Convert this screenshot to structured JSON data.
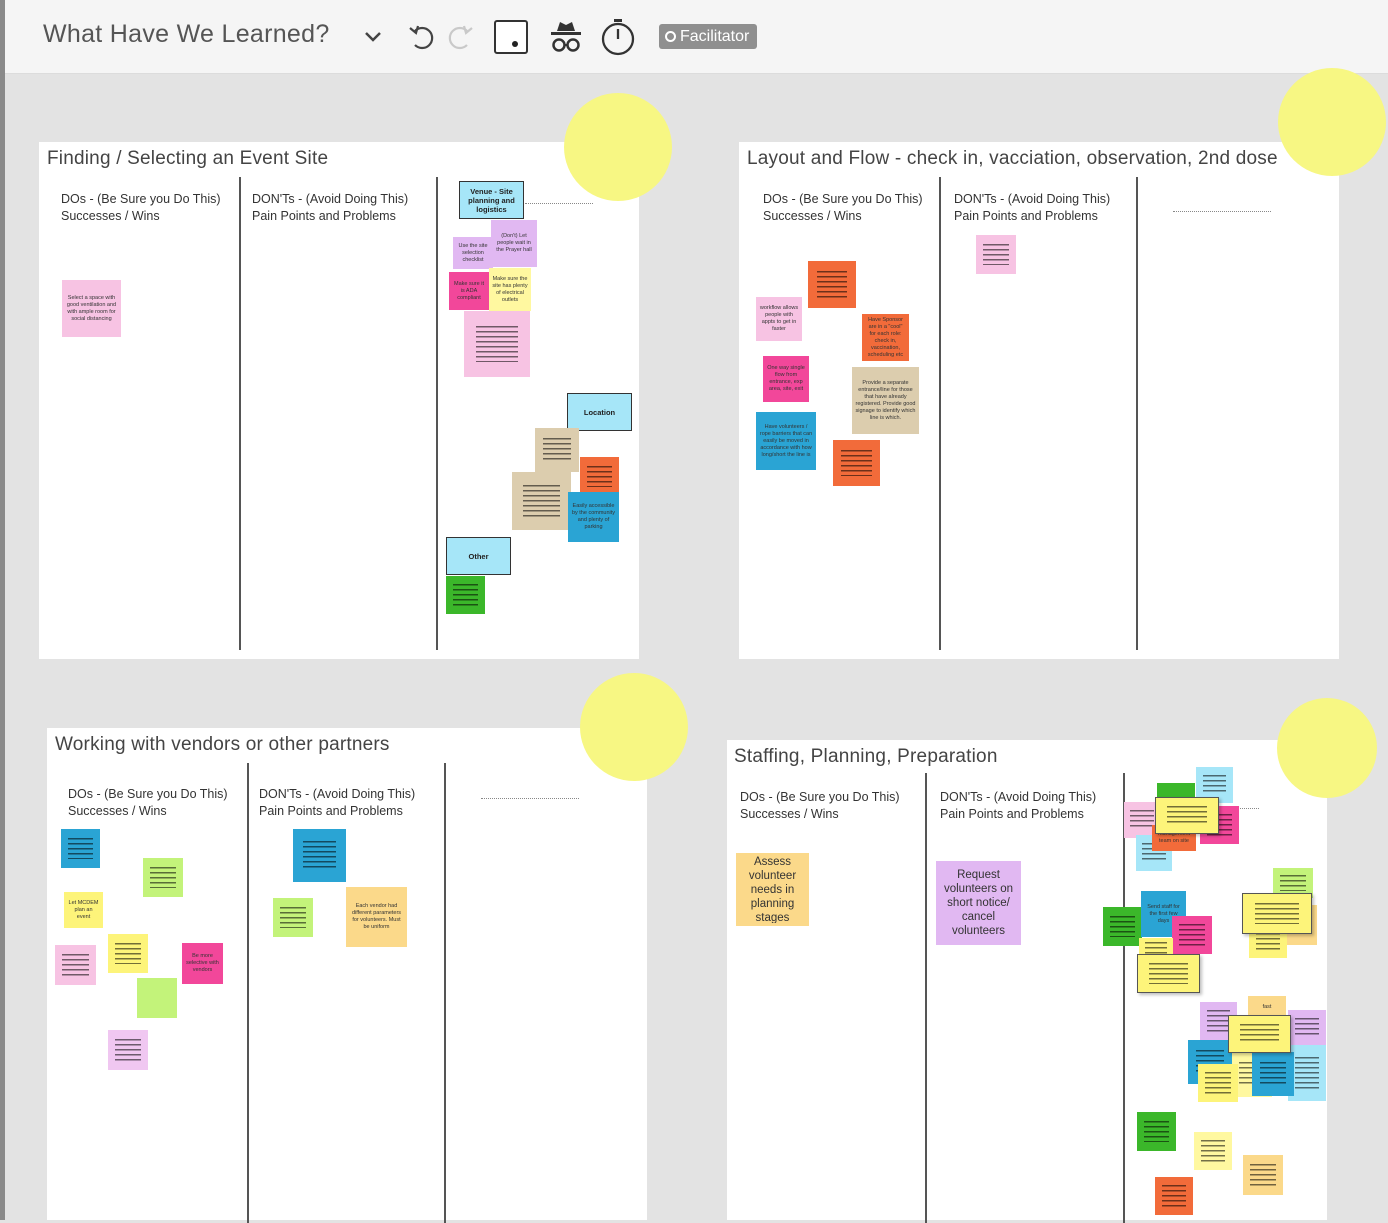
{
  "header": {
    "title": "What Have We Learned?",
    "facilitator_label": "Facilitator"
  },
  "icons": [
    "chevron-down-icon",
    "undo-icon",
    "redo-icon",
    "sticky-note-icon",
    "incognito-icon",
    "timer-icon",
    "facilitator-icon"
  ],
  "colors": {
    "yellow": "#fdf47a",
    "light_yellow": "#fff8a0",
    "pink": "#f7c3e3",
    "hot_pink": "#f2479a",
    "orange": "#f26b3a",
    "tan": "#dccdae",
    "blue": "#2aa4d4",
    "light_blue": "#a6e6f8",
    "green": "#3bb72a",
    "lime": "#c3f37a",
    "peach": "#fbd98a",
    "lavender": "#e1b8f2",
    "sun": "#f7f783"
  },
  "panels": [
    {
      "title": "Finding / Selecting an Event Site",
      "col1": [
        "DOs - (Be Sure you Do This)",
        "Successes / Wins"
      ],
      "col2": [
        "DON'Ts - (Avoid Doing This)",
        "Pain Points and Problems"
      ],
      "labels": [
        "Venue - Site planning and logistics",
        "Location",
        "Other"
      ],
      "notes": [
        "Select a space with good ventilation and with ample room for social distancing",
        "Use the site selection checklist",
        "(Don't) Let people wait in the Prayer hall",
        "Make sure it is ADA compliant",
        "Make sure the site has plenty of electrical outlets",
        "Easily accessible by the community and plenty of parking"
      ]
    },
    {
      "title": "Layout and Flow - check in, vacciation, observation, 2nd dose",
      "col1": [
        "DOs - (Be Sure you Do This)",
        "Successes / Wins"
      ],
      "col2": [
        "DON'Ts - (Avoid Doing This)",
        "Pain Points and Problems"
      ],
      "notes": [
        "workflow allows people with appts to get in faster",
        "Have Sponsor are in a \"cool\" for each role: check in, vaccination, scheduling etc",
        "One way single flow from entrance, exp area, site, exit",
        "Provide a separate entrance/line for those that have already registered. Provide good signage to identify which line is which.",
        "Have volunteers / rope barriers that can easily be moved in accordance with how long/short the line is"
      ]
    },
    {
      "title": "Working with vendors or other partners",
      "col1": [
        "DOs - (Be Sure you Do This)",
        "Successes / Wins"
      ],
      "col2": [
        "DON'Ts - (Avoid Doing This)",
        "Pain Points and Problems"
      ],
      "notes": [
        "Let MCDEM plan an event",
        "Be more selective with vendors",
        "Each vendor had different parameters for volunteers. Must be uniform"
      ]
    },
    {
      "title": "Staffing, Planning, Preparation",
      "col1": [
        "DOs - (Be Sure you Do This)",
        "Successes / Wins"
      ],
      "col2": [
        "DON'Ts - (Avoid Doing This)",
        "Pain Points and Problems"
      ],
      "notes": [
        "Assess volunteer needs in planning stages",
        "Request volunteers on short notice/ cancel volunteers",
        "Send staff for the first few days",
        "management team on site",
        "fast"
      ]
    }
  ]
}
